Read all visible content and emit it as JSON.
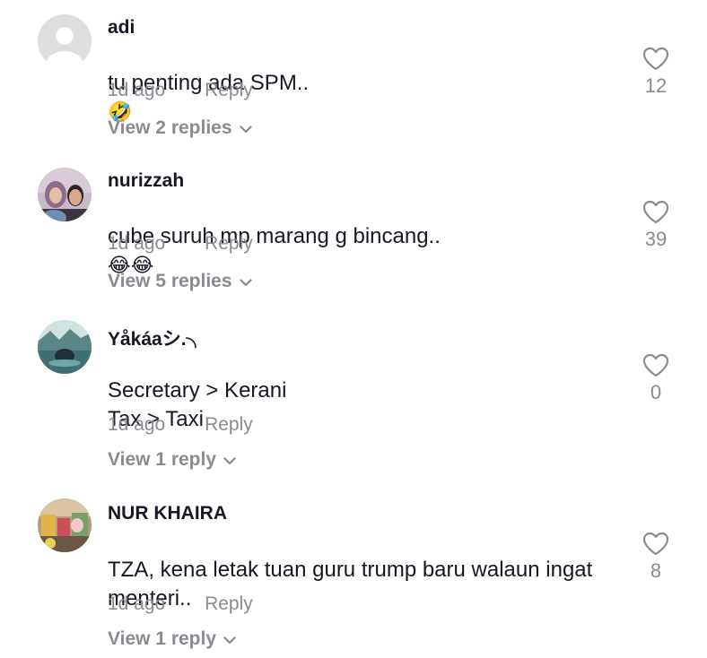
{
  "comments": [
    {
      "username": "adi",
      "text": "tu penting ada SPM..",
      "emoji": "🤣",
      "time": "1d ago",
      "reply_label": "Reply",
      "view_replies": "View 2 replies",
      "likes": "12",
      "avatar": "default-avatar"
    },
    {
      "username": "nurizzah",
      "text": "cube suruh mp marang g bincang..",
      "emoji": "😂😂",
      "time": "1d ago",
      "reply_label": "Reply",
      "view_replies": "View 5 replies",
      "likes": "39",
      "avatar": "photo-avatar"
    },
    {
      "username": "Yåkáaシ.╮",
      "text": "Secretary > Kerani\nTax > Taxi",
      "emoji": "",
      "time": "1d ago",
      "reply_label": "Reply",
      "view_replies": "View 1 reply",
      "likes": "0",
      "avatar": "photo-avatar"
    },
    {
      "username": "NUR KHAIRA",
      "text": "TZA, kena letak tuan guru trump baru walaun ingat menteri..",
      "emoji": "",
      "time": "1d ago",
      "reply_label": "Reply",
      "view_replies": "View 1 reply",
      "likes": "8",
      "avatar": "photo-avatar"
    }
  ],
  "icons": {
    "like": "heart-outline-icon",
    "expand": "chevron-down-icon"
  },
  "colors": {
    "primary_text": "#161823",
    "secondary_text": "#8a8b91"
  }
}
